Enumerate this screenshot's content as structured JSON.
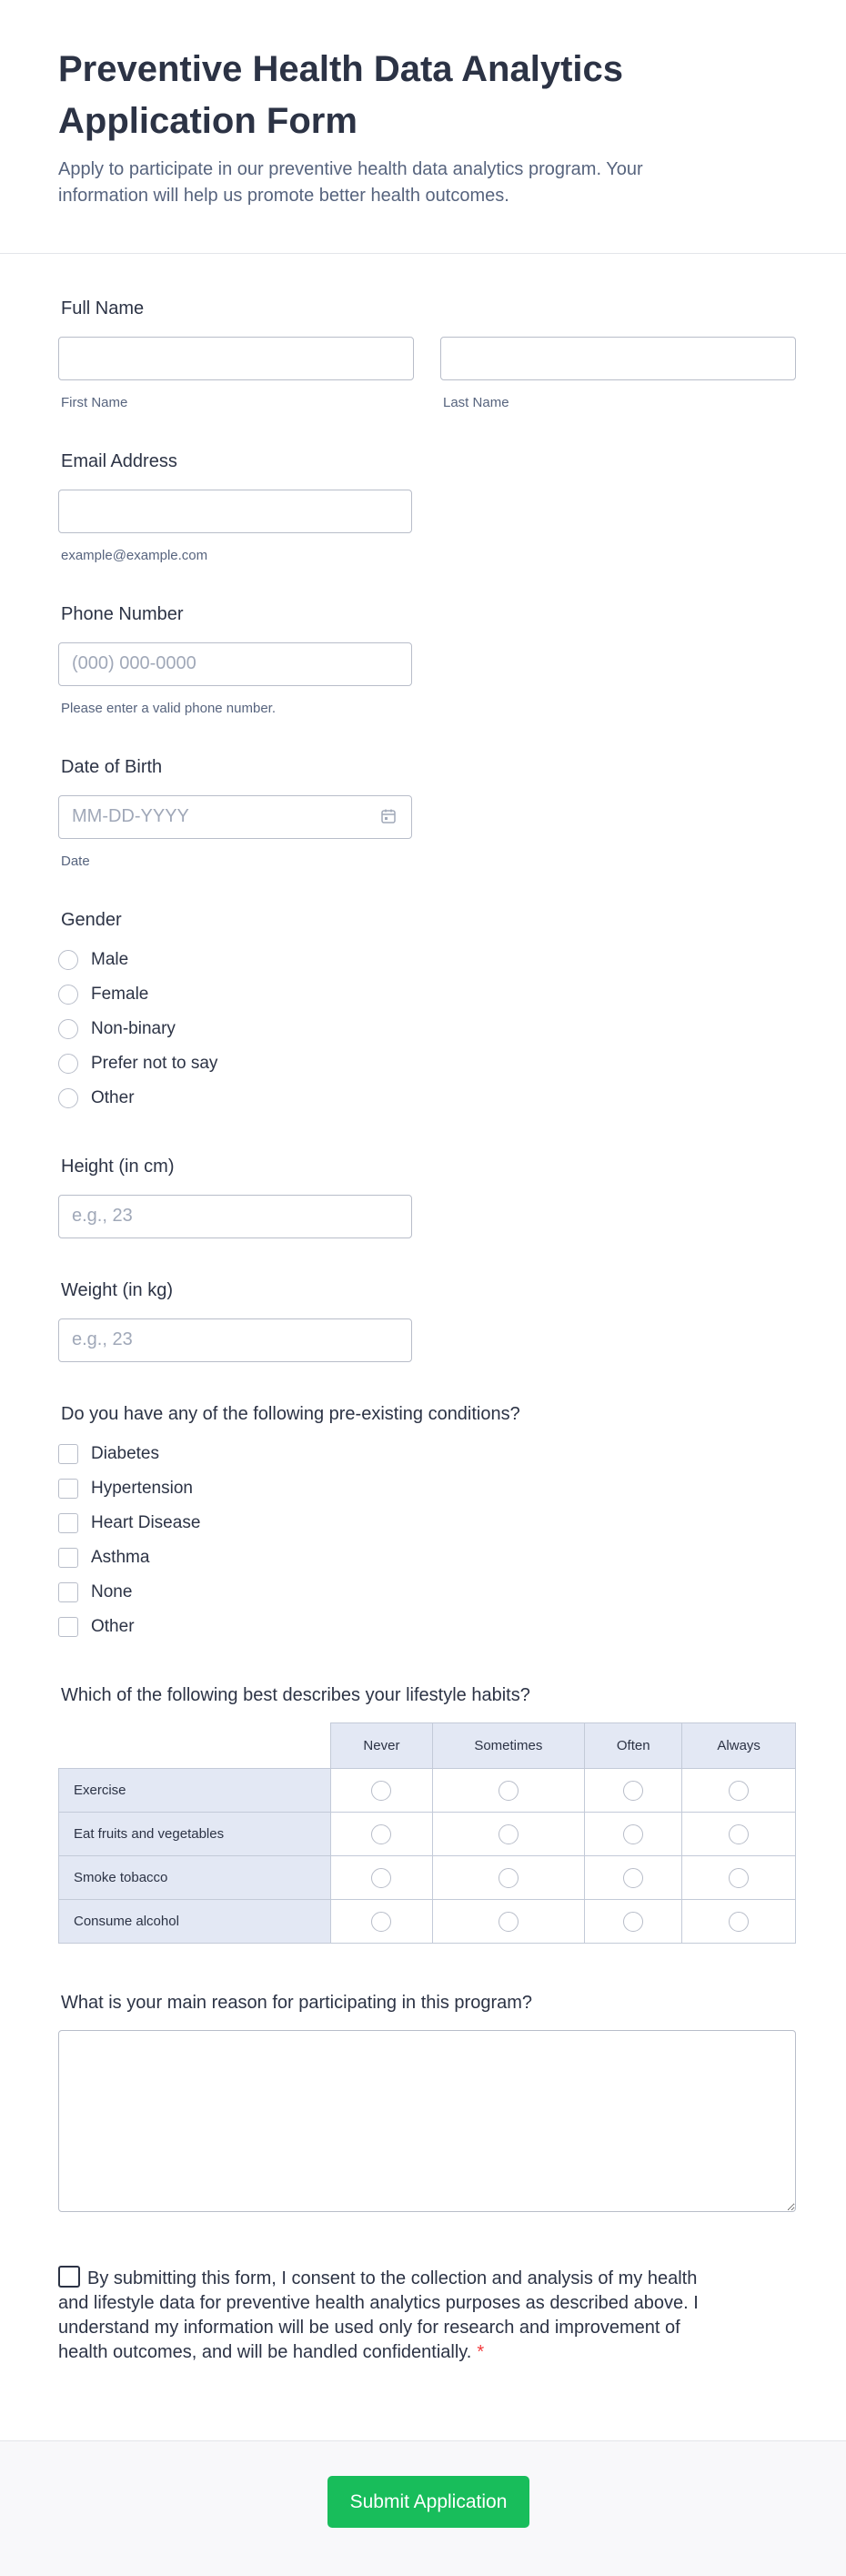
{
  "header": {
    "title": "Preventive Health Data Analytics Application Form",
    "subtitle": "Apply to participate in our preventive health data analytics program. Your information will help us promote better health outcomes."
  },
  "full_name": {
    "label": "Full Name",
    "first_sub": "First Name",
    "last_sub": "Last Name"
  },
  "email": {
    "label": "Email Address",
    "sub": "example@example.com"
  },
  "phone": {
    "label": "Phone Number",
    "placeholder": "(000) 000-0000",
    "sub": "Please enter a valid phone number."
  },
  "dob": {
    "label": "Date of Birth",
    "placeholder": "MM-DD-YYYY",
    "sub": "Date",
    "icon": "calendar-icon"
  },
  "gender": {
    "label": "Gender",
    "options": [
      "Male",
      "Female",
      "Non-binary",
      "Prefer not to say",
      "Other"
    ]
  },
  "height": {
    "label": "Height (in cm)",
    "placeholder": "e.g., 23"
  },
  "weight": {
    "label": "Weight (in kg)",
    "placeholder": "e.g., 23"
  },
  "conditions": {
    "label": "Do you have any of the following pre-existing conditions?",
    "options": [
      "Diabetes",
      "Hypertension",
      "Heart Disease",
      "Asthma",
      "None",
      "Other"
    ]
  },
  "lifestyle": {
    "label": "Which of the following best describes your lifestyle habits?",
    "columns": [
      "Never",
      "Sometimes",
      "Often",
      "Always"
    ],
    "rows": [
      "Exercise",
      "Eat fruits and vegetables",
      "Smoke tobacco",
      "Consume alcohol"
    ]
  },
  "reason": {
    "label": "What is your main reason for participating in this program?"
  },
  "consent": {
    "text": "By submitting this form, I consent to the collection and analysis of my health and lifestyle data for preventive health analytics purposes as described above. I understand my information will be used only for research and improvement of health outcomes, and will be handled confidentially.",
    "required_mark": "*"
  },
  "submit": {
    "label": "Submit Application"
  },
  "colors": {
    "accent": "#18bd5b",
    "required": "#f23a3c",
    "text": "#2c3345",
    "matrix_header": "#e3e8f4"
  }
}
